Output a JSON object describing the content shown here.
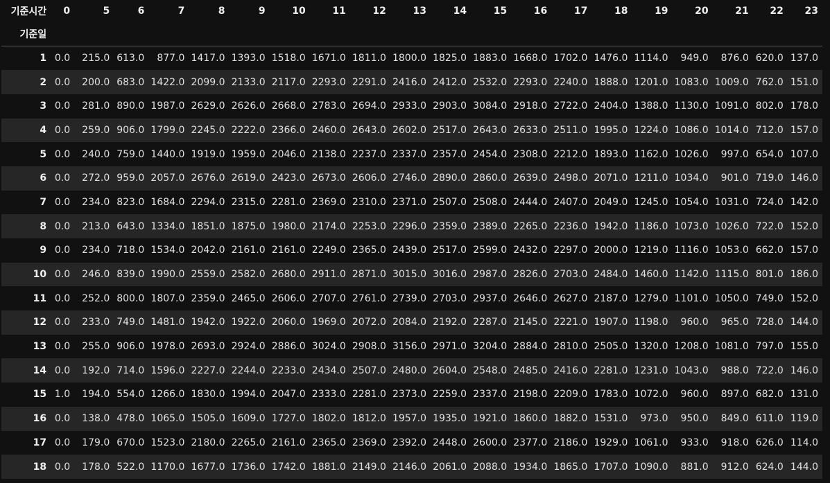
{
  "table": {
    "columns_name": "기준시간",
    "index_name": "기준일",
    "columns": [
      "0",
      "5",
      "6",
      "7",
      "8",
      "9",
      "10",
      "11",
      "12",
      "13",
      "14",
      "15",
      "16",
      "17",
      "18",
      "19",
      "20",
      "21",
      "22",
      "23"
    ],
    "rows": [
      {
        "index": "1",
        "values": [
          "0.0",
          "215.0",
          "613.0",
          "877.0",
          "1417.0",
          "1393.0",
          "1518.0",
          "1671.0",
          "1811.0",
          "1800.0",
          "1825.0",
          "1883.0",
          "1668.0",
          "1702.0",
          "1476.0",
          "1114.0",
          "949.0",
          "876.0",
          "620.0",
          "137.0"
        ]
      },
      {
        "index": "2",
        "values": [
          "0.0",
          "200.0",
          "683.0",
          "1422.0",
          "2099.0",
          "2133.0",
          "2117.0",
          "2293.0",
          "2291.0",
          "2416.0",
          "2412.0",
          "2532.0",
          "2293.0",
          "2240.0",
          "1888.0",
          "1201.0",
          "1083.0",
          "1009.0",
          "762.0",
          "151.0"
        ]
      },
      {
        "index": "3",
        "values": [
          "0.0",
          "281.0",
          "890.0",
          "1987.0",
          "2629.0",
          "2626.0",
          "2668.0",
          "2783.0",
          "2694.0",
          "2933.0",
          "2903.0",
          "3084.0",
          "2918.0",
          "2722.0",
          "2404.0",
          "1388.0",
          "1130.0",
          "1091.0",
          "802.0",
          "178.0"
        ]
      },
      {
        "index": "4",
        "values": [
          "0.0",
          "259.0",
          "906.0",
          "1799.0",
          "2245.0",
          "2222.0",
          "2366.0",
          "2460.0",
          "2643.0",
          "2602.0",
          "2517.0",
          "2643.0",
          "2633.0",
          "2511.0",
          "1995.0",
          "1224.0",
          "1086.0",
          "1014.0",
          "712.0",
          "157.0"
        ]
      },
      {
        "index": "5",
        "values": [
          "0.0",
          "240.0",
          "759.0",
          "1440.0",
          "1919.0",
          "1959.0",
          "2046.0",
          "2138.0",
          "2237.0",
          "2337.0",
          "2357.0",
          "2454.0",
          "2308.0",
          "2212.0",
          "1893.0",
          "1162.0",
          "1026.0",
          "997.0",
          "654.0",
          "107.0"
        ]
      },
      {
        "index": "6",
        "values": [
          "0.0",
          "272.0",
          "959.0",
          "2057.0",
          "2676.0",
          "2619.0",
          "2423.0",
          "2673.0",
          "2606.0",
          "2746.0",
          "2890.0",
          "2860.0",
          "2639.0",
          "2498.0",
          "2071.0",
          "1211.0",
          "1034.0",
          "901.0",
          "719.0",
          "146.0"
        ]
      },
      {
        "index": "7",
        "values": [
          "0.0",
          "234.0",
          "823.0",
          "1684.0",
          "2294.0",
          "2315.0",
          "2281.0",
          "2369.0",
          "2310.0",
          "2371.0",
          "2507.0",
          "2508.0",
          "2444.0",
          "2407.0",
          "2049.0",
          "1245.0",
          "1054.0",
          "1031.0",
          "724.0",
          "142.0"
        ]
      },
      {
        "index": "8",
        "values": [
          "0.0",
          "213.0",
          "643.0",
          "1334.0",
          "1851.0",
          "1875.0",
          "1980.0",
          "2174.0",
          "2253.0",
          "2296.0",
          "2359.0",
          "2389.0",
          "2265.0",
          "2236.0",
          "1942.0",
          "1186.0",
          "1073.0",
          "1026.0",
          "722.0",
          "152.0"
        ]
      },
      {
        "index": "9",
        "values": [
          "0.0",
          "234.0",
          "718.0",
          "1534.0",
          "2042.0",
          "2161.0",
          "2161.0",
          "2249.0",
          "2365.0",
          "2439.0",
          "2517.0",
          "2599.0",
          "2432.0",
          "2297.0",
          "2000.0",
          "1219.0",
          "1116.0",
          "1053.0",
          "662.0",
          "157.0"
        ]
      },
      {
        "index": "10",
        "values": [
          "0.0",
          "246.0",
          "839.0",
          "1990.0",
          "2559.0",
          "2582.0",
          "2680.0",
          "2911.0",
          "2871.0",
          "3015.0",
          "3016.0",
          "2987.0",
          "2826.0",
          "2703.0",
          "2484.0",
          "1460.0",
          "1142.0",
          "1115.0",
          "801.0",
          "186.0"
        ]
      },
      {
        "index": "11",
        "values": [
          "0.0",
          "252.0",
          "800.0",
          "1807.0",
          "2359.0",
          "2465.0",
          "2606.0",
          "2707.0",
          "2761.0",
          "2739.0",
          "2703.0",
          "2937.0",
          "2646.0",
          "2627.0",
          "2187.0",
          "1279.0",
          "1101.0",
          "1050.0",
          "749.0",
          "152.0"
        ]
      },
      {
        "index": "12",
        "values": [
          "0.0",
          "233.0",
          "749.0",
          "1481.0",
          "1942.0",
          "1922.0",
          "2060.0",
          "1969.0",
          "2072.0",
          "2084.0",
          "2192.0",
          "2287.0",
          "2145.0",
          "2221.0",
          "1907.0",
          "1198.0",
          "960.0",
          "965.0",
          "728.0",
          "144.0"
        ]
      },
      {
        "index": "13",
        "values": [
          "0.0",
          "255.0",
          "906.0",
          "1978.0",
          "2693.0",
          "2924.0",
          "2886.0",
          "3024.0",
          "2908.0",
          "3156.0",
          "2971.0",
          "3204.0",
          "2884.0",
          "2810.0",
          "2505.0",
          "1320.0",
          "1208.0",
          "1081.0",
          "797.0",
          "155.0"
        ]
      },
      {
        "index": "14",
        "values": [
          "0.0",
          "192.0",
          "714.0",
          "1596.0",
          "2227.0",
          "2244.0",
          "2233.0",
          "2434.0",
          "2507.0",
          "2480.0",
          "2604.0",
          "2548.0",
          "2485.0",
          "2416.0",
          "2281.0",
          "1231.0",
          "1043.0",
          "988.0",
          "722.0",
          "146.0"
        ]
      },
      {
        "index": "15",
        "values": [
          "1.0",
          "194.0",
          "554.0",
          "1266.0",
          "1830.0",
          "1994.0",
          "2047.0",
          "2333.0",
          "2281.0",
          "2373.0",
          "2259.0",
          "2337.0",
          "2198.0",
          "2209.0",
          "1783.0",
          "1072.0",
          "960.0",
          "897.0",
          "682.0",
          "131.0"
        ]
      },
      {
        "index": "16",
        "values": [
          "0.0",
          "138.0",
          "478.0",
          "1065.0",
          "1505.0",
          "1609.0",
          "1727.0",
          "1802.0",
          "1812.0",
          "1957.0",
          "1935.0",
          "1921.0",
          "1860.0",
          "1882.0",
          "1531.0",
          "973.0",
          "950.0",
          "849.0",
          "611.0",
          "119.0"
        ]
      },
      {
        "index": "17",
        "values": [
          "0.0",
          "179.0",
          "670.0",
          "1523.0",
          "2180.0",
          "2265.0",
          "2161.0",
          "2365.0",
          "2369.0",
          "2392.0",
          "2448.0",
          "2600.0",
          "2377.0",
          "2186.0",
          "1929.0",
          "1061.0",
          "933.0",
          "918.0",
          "626.0",
          "114.0"
        ]
      },
      {
        "index": "18",
        "values": [
          "0.0",
          "178.0",
          "522.0",
          "1170.0",
          "1677.0",
          "1736.0",
          "1742.0",
          "1881.0",
          "2149.0",
          "2146.0",
          "2061.0",
          "2088.0",
          "1934.0",
          "1865.0",
          "1707.0",
          "1090.0",
          "881.0",
          "912.0",
          "624.0",
          "144.0"
        ]
      }
    ]
  },
  "colors": {
    "background": "#111111",
    "stripe": "#262626",
    "text": "#e0e0e0"
  }
}
